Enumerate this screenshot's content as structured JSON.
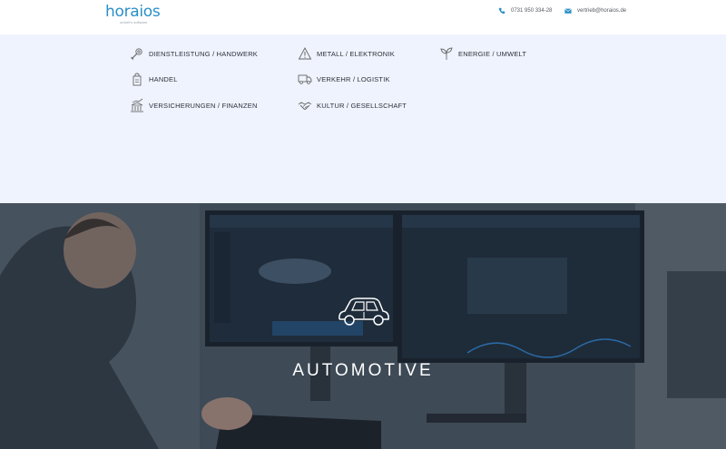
{
  "brand": {
    "name": "horaios",
    "tagline": "ordnet's software",
    "accent_color": "#2a8fc7"
  },
  "contact": {
    "phone": "0731 950 334-28",
    "email": "vertrieb@horaios.de"
  },
  "menu": {
    "items": [
      {
        "label": "DIENSTLEISTUNG / HANDWERK",
        "icon": "tools-icon"
      },
      {
        "label": "METALL / ELEKTRONIK",
        "icon": "warning-icon"
      },
      {
        "label": "ENERGIE / UMWELT",
        "icon": "plant-icon"
      },
      {
        "label": "HANDEL",
        "icon": "shopping-bag-icon"
      },
      {
        "label": "VERKEHR / LOGISTIK",
        "icon": "truck-icon"
      },
      {
        "label": "VERSICHERUNGEN / FINANZEN",
        "icon": "chart-bank-icon"
      },
      {
        "label": "KULTUR / GESELLSCHAFT",
        "icon": "handshake-icon"
      }
    ]
  },
  "hero": {
    "title": "AUTOMOTIVE",
    "icon": "car-icon"
  }
}
